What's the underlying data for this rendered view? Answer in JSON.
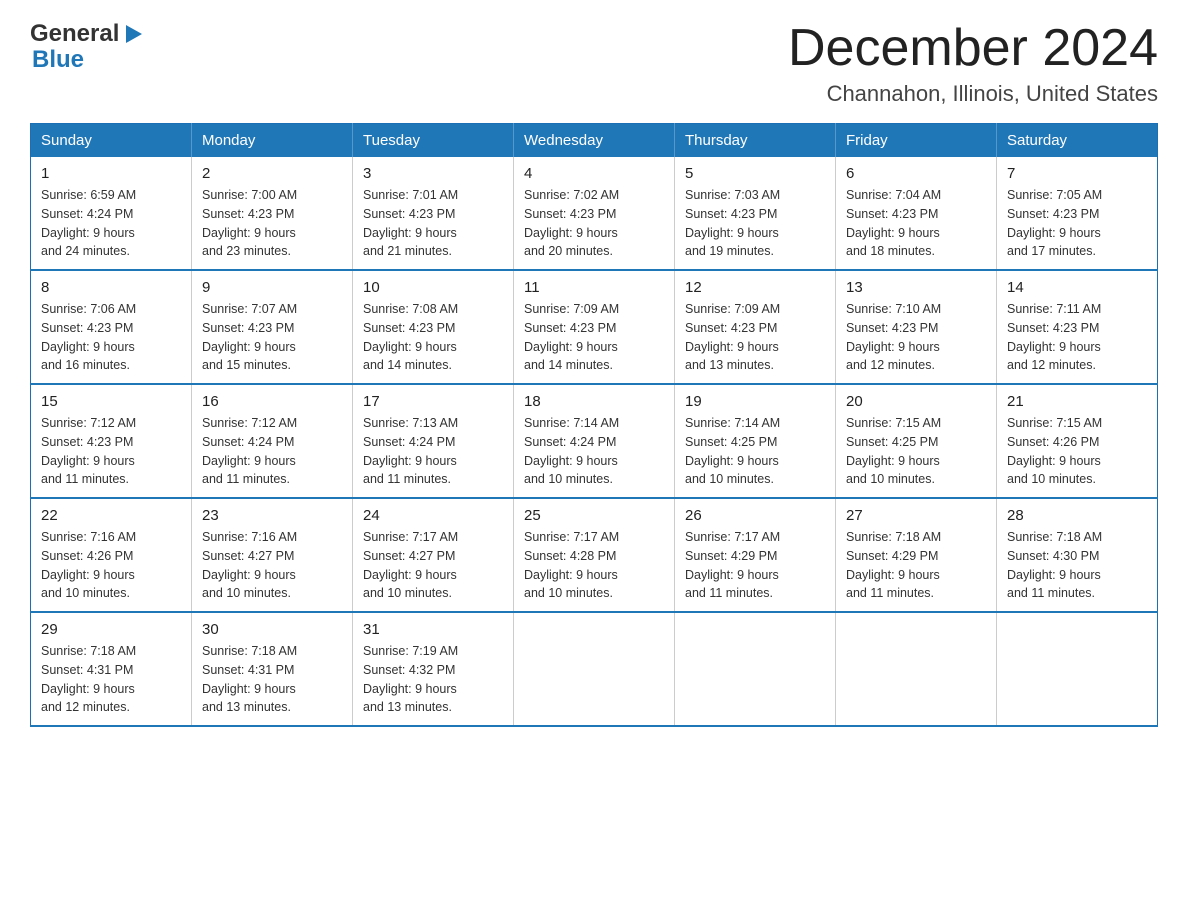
{
  "header": {
    "logo_general": "General",
    "logo_blue": "Blue",
    "month_title": "December 2024",
    "location": "Channahon, Illinois, United States"
  },
  "weekdays": [
    "Sunday",
    "Monday",
    "Tuesday",
    "Wednesday",
    "Thursday",
    "Friday",
    "Saturday"
  ],
  "weeks": [
    [
      {
        "day": "1",
        "sunrise": "Sunrise: 6:59 AM",
        "sunset": "Sunset: 4:24 PM",
        "daylight": "Daylight: 9 hours and 24 minutes."
      },
      {
        "day": "2",
        "sunrise": "Sunrise: 7:00 AM",
        "sunset": "Sunset: 4:23 PM",
        "daylight": "Daylight: 9 hours and 23 minutes."
      },
      {
        "day": "3",
        "sunrise": "Sunrise: 7:01 AM",
        "sunset": "Sunset: 4:23 PM",
        "daylight": "Daylight: 9 hours and 21 minutes."
      },
      {
        "day": "4",
        "sunrise": "Sunrise: 7:02 AM",
        "sunset": "Sunset: 4:23 PM",
        "daylight": "Daylight: 9 hours and 20 minutes."
      },
      {
        "day": "5",
        "sunrise": "Sunrise: 7:03 AM",
        "sunset": "Sunset: 4:23 PM",
        "daylight": "Daylight: 9 hours and 19 minutes."
      },
      {
        "day": "6",
        "sunrise": "Sunrise: 7:04 AM",
        "sunset": "Sunset: 4:23 PM",
        "daylight": "Daylight: 9 hours and 18 minutes."
      },
      {
        "day": "7",
        "sunrise": "Sunrise: 7:05 AM",
        "sunset": "Sunset: 4:23 PM",
        "daylight": "Daylight: 9 hours and 17 minutes."
      }
    ],
    [
      {
        "day": "8",
        "sunrise": "Sunrise: 7:06 AM",
        "sunset": "Sunset: 4:23 PM",
        "daylight": "Daylight: 9 hours and 16 minutes."
      },
      {
        "day": "9",
        "sunrise": "Sunrise: 7:07 AM",
        "sunset": "Sunset: 4:23 PM",
        "daylight": "Daylight: 9 hours and 15 minutes."
      },
      {
        "day": "10",
        "sunrise": "Sunrise: 7:08 AM",
        "sunset": "Sunset: 4:23 PM",
        "daylight": "Daylight: 9 hours and 14 minutes."
      },
      {
        "day": "11",
        "sunrise": "Sunrise: 7:09 AM",
        "sunset": "Sunset: 4:23 PM",
        "daylight": "Daylight: 9 hours and 14 minutes."
      },
      {
        "day": "12",
        "sunrise": "Sunrise: 7:09 AM",
        "sunset": "Sunset: 4:23 PM",
        "daylight": "Daylight: 9 hours and 13 minutes."
      },
      {
        "day": "13",
        "sunrise": "Sunrise: 7:10 AM",
        "sunset": "Sunset: 4:23 PM",
        "daylight": "Daylight: 9 hours and 12 minutes."
      },
      {
        "day": "14",
        "sunrise": "Sunrise: 7:11 AM",
        "sunset": "Sunset: 4:23 PM",
        "daylight": "Daylight: 9 hours and 12 minutes."
      }
    ],
    [
      {
        "day": "15",
        "sunrise": "Sunrise: 7:12 AM",
        "sunset": "Sunset: 4:23 PM",
        "daylight": "Daylight: 9 hours and 11 minutes."
      },
      {
        "day": "16",
        "sunrise": "Sunrise: 7:12 AM",
        "sunset": "Sunset: 4:24 PM",
        "daylight": "Daylight: 9 hours and 11 minutes."
      },
      {
        "day": "17",
        "sunrise": "Sunrise: 7:13 AM",
        "sunset": "Sunset: 4:24 PM",
        "daylight": "Daylight: 9 hours and 11 minutes."
      },
      {
        "day": "18",
        "sunrise": "Sunrise: 7:14 AM",
        "sunset": "Sunset: 4:24 PM",
        "daylight": "Daylight: 9 hours and 10 minutes."
      },
      {
        "day": "19",
        "sunrise": "Sunrise: 7:14 AM",
        "sunset": "Sunset: 4:25 PM",
        "daylight": "Daylight: 9 hours and 10 minutes."
      },
      {
        "day": "20",
        "sunrise": "Sunrise: 7:15 AM",
        "sunset": "Sunset: 4:25 PM",
        "daylight": "Daylight: 9 hours and 10 minutes."
      },
      {
        "day": "21",
        "sunrise": "Sunrise: 7:15 AM",
        "sunset": "Sunset: 4:26 PM",
        "daylight": "Daylight: 9 hours and 10 minutes."
      }
    ],
    [
      {
        "day": "22",
        "sunrise": "Sunrise: 7:16 AM",
        "sunset": "Sunset: 4:26 PM",
        "daylight": "Daylight: 9 hours and 10 minutes."
      },
      {
        "day": "23",
        "sunrise": "Sunrise: 7:16 AM",
        "sunset": "Sunset: 4:27 PM",
        "daylight": "Daylight: 9 hours and 10 minutes."
      },
      {
        "day": "24",
        "sunrise": "Sunrise: 7:17 AM",
        "sunset": "Sunset: 4:27 PM",
        "daylight": "Daylight: 9 hours and 10 minutes."
      },
      {
        "day": "25",
        "sunrise": "Sunrise: 7:17 AM",
        "sunset": "Sunset: 4:28 PM",
        "daylight": "Daylight: 9 hours and 10 minutes."
      },
      {
        "day": "26",
        "sunrise": "Sunrise: 7:17 AM",
        "sunset": "Sunset: 4:29 PM",
        "daylight": "Daylight: 9 hours and 11 minutes."
      },
      {
        "day": "27",
        "sunrise": "Sunrise: 7:18 AM",
        "sunset": "Sunset: 4:29 PM",
        "daylight": "Daylight: 9 hours and 11 minutes."
      },
      {
        "day": "28",
        "sunrise": "Sunrise: 7:18 AM",
        "sunset": "Sunset: 4:30 PM",
        "daylight": "Daylight: 9 hours and 11 minutes."
      }
    ],
    [
      {
        "day": "29",
        "sunrise": "Sunrise: 7:18 AM",
        "sunset": "Sunset: 4:31 PM",
        "daylight": "Daylight: 9 hours and 12 minutes."
      },
      {
        "day": "30",
        "sunrise": "Sunrise: 7:18 AM",
        "sunset": "Sunset: 4:31 PM",
        "daylight": "Daylight: 9 hours and 13 minutes."
      },
      {
        "day": "31",
        "sunrise": "Sunrise: 7:19 AM",
        "sunset": "Sunset: 4:32 PM",
        "daylight": "Daylight: 9 hours and 13 minutes."
      },
      null,
      null,
      null,
      null
    ]
  ]
}
